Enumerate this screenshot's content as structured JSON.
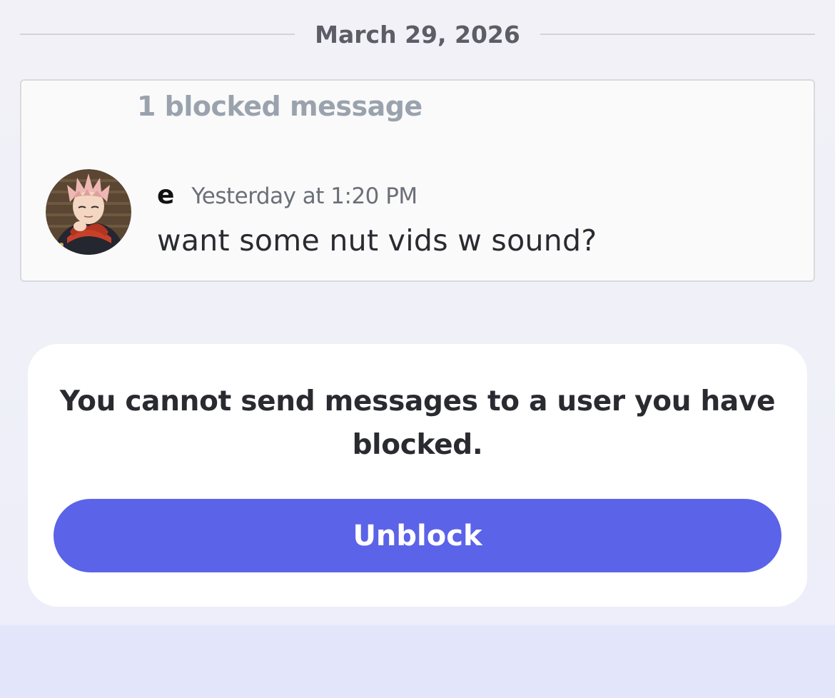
{
  "date_divider": {
    "label": "March 29, 2026"
  },
  "blocked_messages": {
    "count_label": "1 blocked message",
    "message": {
      "author": "e",
      "timestamp": "Yesterday at 1:20 PM",
      "text": "want some nut vids w sound?",
      "avatar_icon": "anime-character-avatar"
    }
  },
  "blocked_notice": {
    "text": "You cannot send messages to a user you have blocked.",
    "button_label": "Unblock"
  },
  "colors": {
    "accent": "#5b63e8",
    "blocked_label": "#9aa3ad",
    "panel_background": "#fafafa",
    "bottom_bar": "#e3e6fa"
  }
}
